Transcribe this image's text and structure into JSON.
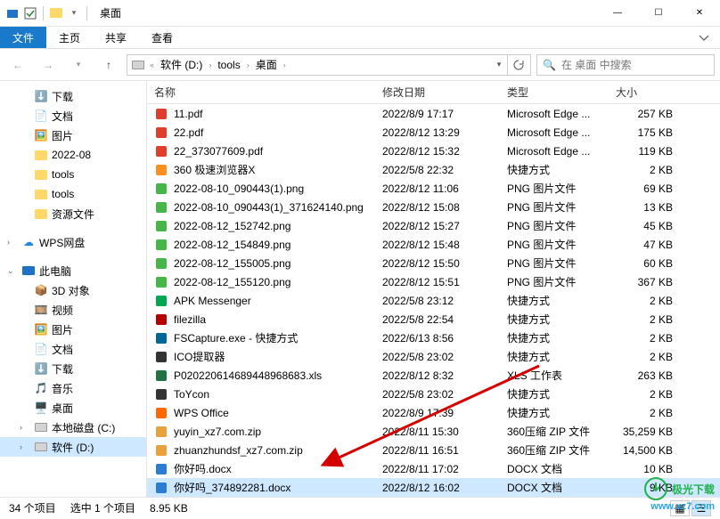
{
  "window": {
    "title": "桌面",
    "controls": {
      "min": "—",
      "max": "☐",
      "close": "✕"
    }
  },
  "ribbon": {
    "file": "文件",
    "home": "主页",
    "share": "共享",
    "view": "查看"
  },
  "address": {
    "seg1": "软件 (D:)",
    "seg2": "tools",
    "seg3": "桌面",
    "search_placeholder": "在 桌面 中搜索"
  },
  "sidebar": {
    "downloads": "下载",
    "documents": "文档",
    "pictures": "图片",
    "folder_2022_08": "2022-08",
    "tools1": "tools",
    "tools2": "tools",
    "resources": "资源文件",
    "wps": "WPS网盘",
    "thispc": "此电脑",
    "objects3d": "3D 对象",
    "videos": "视频",
    "pictures2": "图片",
    "documents2": "文档",
    "downloads2": "下载",
    "music": "音乐",
    "desktop2": "桌面",
    "diskc": "本地磁盘 (C:)",
    "diskd": "软件 (D:)"
  },
  "columns": {
    "name": "名称",
    "date": "修改日期",
    "type": "类型",
    "size": "大小"
  },
  "rows": [
    {
      "icon": "pdf",
      "name": "11.pdf",
      "date": "2022/8/9 17:17",
      "type": "Microsoft Edge ...",
      "size": "257 KB"
    },
    {
      "icon": "pdf",
      "name": "22.pdf",
      "date": "2022/8/12 13:29",
      "type": "Microsoft Edge ...",
      "size": "175 KB"
    },
    {
      "icon": "pdf",
      "name": "22_373077609.pdf",
      "date": "2022/8/12 15:32",
      "type": "Microsoft Edge ...",
      "size": "119 KB"
    },
    {
      "icon": "app",
      "name": "360 极速浏览器X",
      "date": "2022/5/8 22:32",
      "type": "快捷方式",
      "size": "2 KB"
    },
    {
      "icon": "png",
      "name": "2022-08-10_090443(1).png",
      "date": "2022/8/12 11:06",
      "type": "PNG 图片文件",
      "size": "69 KB"
    },
    {
      "icon": "png",
      "name": "2022-08-10_090443(1)_371624140.png",
      "date": "2022/8/12 15:08",
      "type": "PNG 图片文件",
      "size": "13 KB"
    },
    {
      "icon": "png",
      "name": "2022-08-12_152742.png",
      "date": "2022/8/12 15:27",
      "type": "PNG 图片文件",
      "size": "45 KB"
    },
    {
      "icon": "png",
      "name": "2022-08-12_154849.png",
      "date": "2022/8/12 15:48",
      "type": "PNG 图片文件",
      "size": "47 KB"
    },
    {
      "icon": "png",
      "name": "2022-08-12_155005.png",
      "date": "2022/8/12 15:50",
      "type": "PNG 图片文件",
      "size": "60 KB"
    },
    {
      "icon": "png",
      "name": "2022-08-12_155120.png",
      "date": "2022/8/12 15:51",
      "type": "PNG 图片文件",
      "size": "367 KB"
    },
    {
      "icon": "apk",
      "name": "APK Messenger",
      "date": "2022/5/8 23:12",
      "type": "快捷方式",
      "size": "2 KB"
    },
    {
      "icon": "fz",
      "name": "filezilla",
      "date": "2022/5/8 22:54",
      "type": "快捷方式",
      "size": "2 KB"
    },
    {
      "icon": "fs",
      "name": "FSCapture.exe - 快捷方式",
      "date": "2022/6/13 8:56",
      "type": "快捷方式",
      "size": "2 KB"
    },
    {
      "icon": "ico",
      "name": "ICO提取器",
      "date": "2022/5/8 23:02",
      "type": "快捷方式",
      "size": "2 KB"
    },
    {
      "icon": "xls",
      "name": "P020220614689448968683.xls",
      "date": "2022/8/12 8:32",
      "type": "XLS 工作表",
      "size": "263 KB"
    },
    {
      "icon": "toy",
      "name": "ToYcon",
      "date": "2022/5/8 23:02",
      "type": "快捷方式",
      "size": "2 KB"
    },
    {
      "icon": "wps",
      "name": "WPS Office",
      "date": "2022/8/9 17:39",
      "type": "快捷方式",
      "size": "2 KB"
    },
    {
      "icon": "zip",
      "name": "yuyin_xz7.com.zip",
      "date": "2022/8/11 15:30",
      "type": "360压缩 ZIP 文件",
      "size": "35,259 KB"
    },
    {
      "icon": "zip",
      "name": "zhuanzhundsf_xz7.com.zip",
      "date": "2022/8/11 16:51",
      "type": "360压缩 ZIP 文件",
      "size": "14,500 KB"
    },
    {
      "icon": "docx",
      "name": "你好吗.docx",
      "date": "2022/8/11 17:02",
      "type": "DOCX 文档",
      "size": "10 KB"
    },
    {
      "icon": "docx",
      "name": "你好吗_374892281.docx",
      "date": "2022/8/12 16:02",
      "type": "DOCX 文档",
      "size": "9 KB",
      "selected": true
    }
  ],
  "status": {
    "items": "34 个项目",
    "selected": "选中 1 个项目",
    "size": "8.95 KB"
  },
  "watermark": {
    "name": "极光下载",
    "url": "www.xz7.com"
  },
  "icon_colors": {
    "pdf": "#e03e2d",
    "png": "#46b648",
    "zip": "#e9a23b",
    "docx": "#2b7cd3",
    "xls": "#217346",
    "app": "#ff8f1f",
    "apk": "#00a651",
    "fz": "#b40000",
    "fs": "#006699",
    "ico": "#333",
    "toy": "#333",
    "wps": "#ff6a00"
  }
}
